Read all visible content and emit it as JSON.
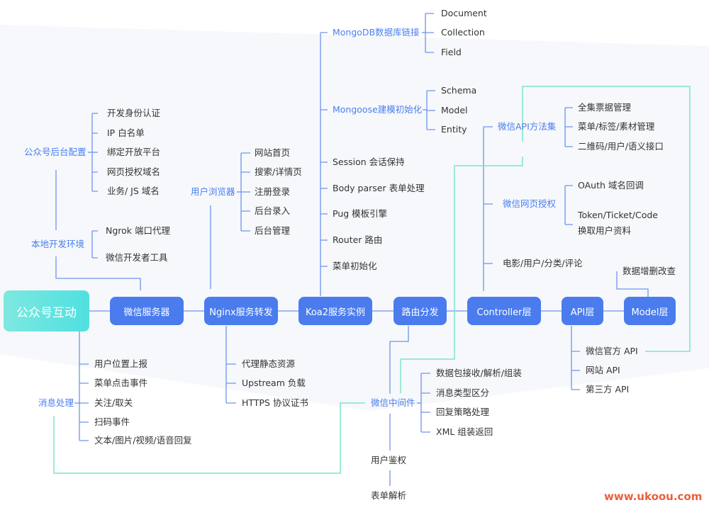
{
  "colors": {
    "node": "#4a7cee",
    "branch_text": "#4a7ef0",
    "tree_line": "#6f93ee",
    "flow_line": "#7ee6c8",
    "root_gradient": [
      "#7ee8e0",
      "#4fe0df"
    ],
    "watermark": "#e8603c"
  },
  "root": {
    "label": "公众号互动"
  },
  "main_chain": [
    "微信服务器",
    "Nginx服务转发",
    "Koa2服务实例",
    "路由分发",
    "Controller层",
    "API层",
    "Model层"
  ],
  "branches": {
    "gzh_config": {
      "label": "公众号后台配置",
      "items": [
        "开发身份认证",
        "IP 白名单",
        "绑定开放平台",
        "网页授权域名",
        "业务/ JS 域名"
      ]
    },
    "local_dev": {
      "label": "本地开发环境",
      "items": [
        "Ngrok 端口代理",
        "微信开发者工具"
      ]
    },
    "browser": {
      "label": "用户浏览器",
      "items": [
        "网站首页",
        "搜索/详情页",
        "注册登录",
        "后台录入",
        "后台管理"
      ]
    },
    "mongodb": {
      "label": "MongoDB数据库链接",
      "items": [
        "Document",
        "Collection",
        "Field"
      ]
    },
    "mongoose": {
      "label": "Mongoose建模初始化",
      "items": [
        "Schema",
        "Model",
        "Entity"
      ]
    },
    "koa_items": [
      "Session 会话保持",
      "Body parser 表单处理",
      "Pug 模板引擎",
      "Router 路由",
      "菜单初始化"
    ],
    "wechat_api": {
      "label": "微信API方法集",
      "items": [
        "全集票据管理",
        "菜单/标签/素材管理",
        "二维码/用户/语义接口"
      ]
    },
    "wechat_oauth": {
      "label": "微信网页授权",
      "items": [
        "OAuth 域名回调",
        "Token/Ticket/Code",
        "换取用户资料"
      ]
    },
    "controller_extra": "电影/用户/分类/评论",
    "model_extra": "数据增删改查",
    "message": {
      "label": "消息处理",
      "items": [
        "用户位置上报",
        "菜单点击事件",
        "关注/取关",
        "扫码事件",
        "文本/图片/视频/语音回复"
      ]
    },
    "nginx_items": [
      "代理静态资源",
      "Upstream 负载",
      "HTTPS 协议证书"
    ],
    "api_items": [
      "微信官方 API",
      "网站 API",
      "第三方 API"
    ],
    "middleware": {
      "label": "微信中间件",
      "items": [
        "数据包接收/解析/组装",
        "消息类型区分",
        "回复策略处理",
        "XML 组装返回"
      ]
    },
    "middleware_chain": [
      "用户鉴权",
      "表单解析"
    ]
  },
  "watermark": "www.ukoou.com"
}
